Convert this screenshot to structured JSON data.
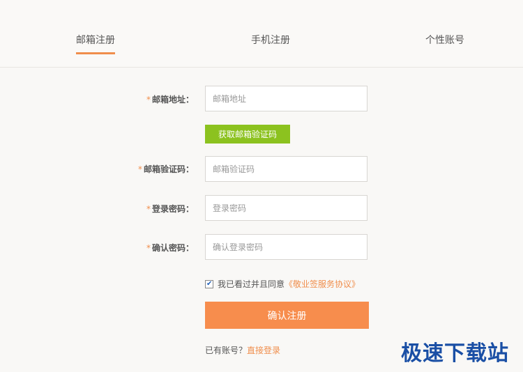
{
  "tabs": [
    {
      "label": "邮箱注册",
      "active": true
    },
    {
      "label": "手机注册",
      "active": false
    },
    {
      "label": "个性账号",
      "active": false
    }
  ],
  "form": {
    "email": {
      "label": "邮箱地址：",
      "placeholder": "邮箱地址",
      "value": ""
    },
    "get_code_button": "获取邮箱验证码",
    "code": {
      "label": "邮箱验证码：",
      "placeholder": "邮箱验证码",
      "value": ""
    },
    "password": {
      "label": "登录密码：",
      "placeholder": "登录密码",
      "value": ""
    },
    "confirm": {
      "label": "确认密码：",
      "placeholder": "确认登录密码",
      "value": ""
    },
    "required_mark": "*",
    "agreement": {
      "checked": true,
      "text": "我已看过并且同意",
      "link": "《敬业签服务协议》"
    },
    "submit_button": "确认注册",
    "have_account": {
      "text": "已有账号？",
      "link": "直接登录"
    }
  },
  "watermark": "极速下载站",
  "colors": {
    "accent": "#f08e4c",
    "green_button": "#8cc21f",
    "submit_button": "#f78d4d",
    "watermark": "#1a4fa5"
  }
}
